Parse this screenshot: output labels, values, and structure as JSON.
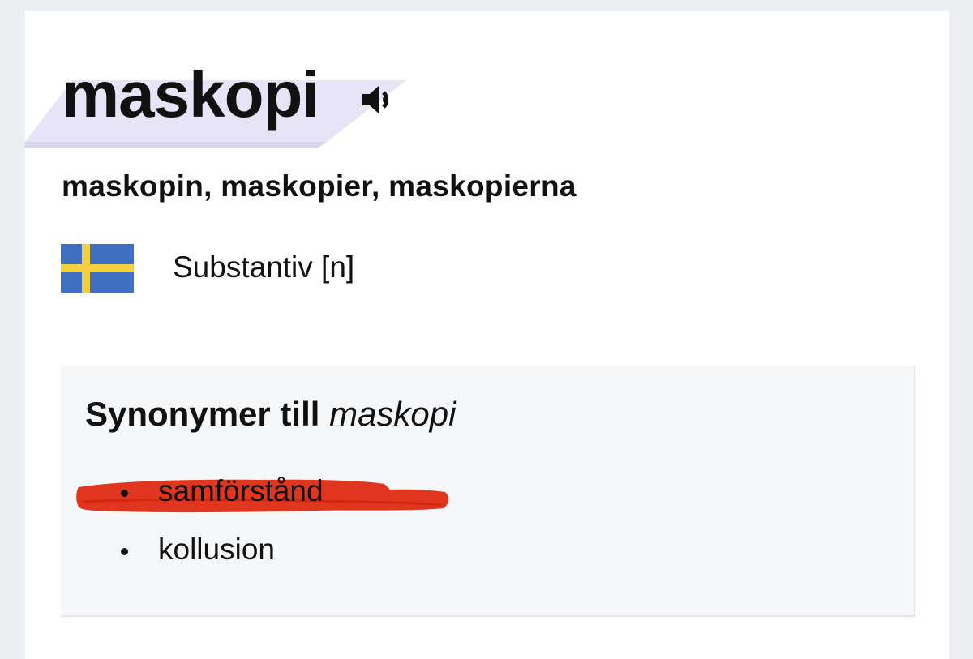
{
  "entry": {
    "headword": "maskopi",
    "inflections": "maskopin, maskopier, maskopierna",
    "part_of_speech": "Substantiv [n]",
    "icons": {
      "audio": "speaker-icon",
      "language": "swedish-flag-icon"
    }
  },
  "synonyms": {
    "title_prefix": "Synonymer till",
    "title_word": "maskopi",
    "items": [
      {
        "label": "samförstånd",
        "scribbled_out": true
      },
      {
        "label": "kollusion",
        "scribbled_out": false
      }
    ]
  },
  "colors": {
    "page_background": "#eceef2",
    "card_background": "#ffffff",
    "headword_highlight": "#e8e4f7",
    "synonym_box_background": "#f6f7f9",
    "flag_blue": "#3f6fc1",
    "flag_yellow": "#f4cf3f",
    "scribble_red": "#de2a12"
  }
}
